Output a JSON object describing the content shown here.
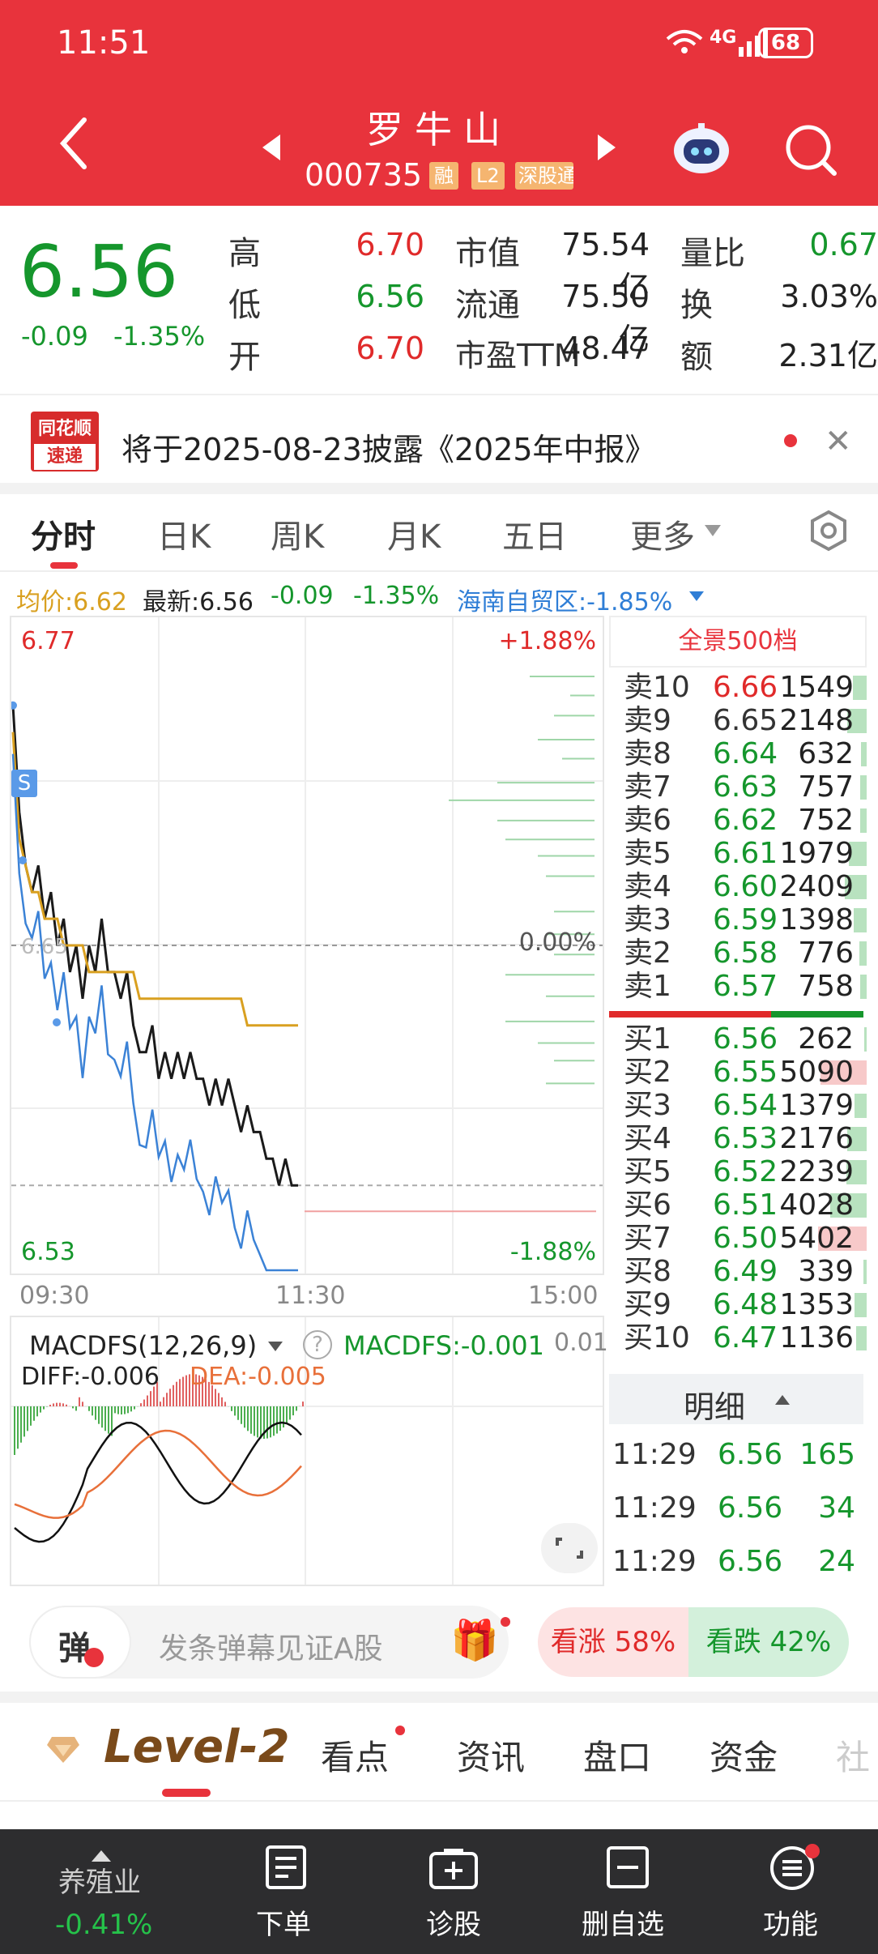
{
  "status": {
    "time": "11:51",
    "network": "4G",
    "battery": "68"
  },
  "header": {
    "name": "罗牛山",
    "code": "000735",
    "tags": [
      "融",
      "L2",
      "深股通"
    ]
  },
  "quote": {
    "price": "6.56",
    "change": "-0.09",
    "change_pct": "-1.35%",
    "stats": [
      {
        "label": "高",
        "value": "6.70"
      },
      {
        "label": "市值",
        "value": "75.54亿"
      },
      {
        "label": "量比",
        "value": "0.67"
      },
      {
        "label": "低",
        "value": "6.56"
      },
      {
        "label": "流通",
        "value": "75.50亿"
      },
      {
        "label": "换",
        "value": "3.03%"
      },
      {
        "label": "开",
        "value": "6.70"
      },
      {
        "label": "市盈TTM",
        "value": "48.47"
      },
      {
        "label": "额",
        "value": "2.31亿"
      }
    ]
  },
  "notice": {
    "badge_top": "同花顺",
    "badge_bottom": "速递",
    "text": "将于2025-08-23披露《2025年中报》"
  },
  "tabs": [
    "分时",
    "日K",
    "周K",
    "月K",
    "五日",
    "更多"
  ],
  "info_bar": {
    "avg": "均价:6.62",
    "latest": "最新:6.56",
    "chg": "-0.09",
    "pct": "-1.35%",
    "sector": "海南自贸区:-1.85%"
  },
  "chart_labels": {
    "top_price": "6.77",
    "bottom_price": "6.53",
    "top_pct": "+1.88%",
    "mid_pct": "0.00%",
    "bottom_pct": "-1.88%",
    "mid_price": "6.65",
    "t_start": "09:30",
    "t_mid": "11:30",
    "t_end": "15:00",
    "s_badge": "S"
  },
  "chart_data": {
    "type": "line",
    "ylim": [
      6.53,
      6.77
    ],
    "series": [
      {
        "name": "price",
        "values": [
          6.74,
          6.7,
          6.68,
          6.67,
          6.68,
          6.66,
          6.67,
          6.65,
          6.66,
          6.64,
          6.65,
          6.63,
          6.65,
          6.64,
          6.66,
          6.64,
          6.64,
          6.63,
          6.64,
          6.62,
          6.61,
          6.61,
          6.62,
          6.6,
          6.61,
          6.6,
          6.61,
          6.6,
          6.61,
          6.6,
          6.6,
          6.59,
          6.6,
          6.59,
          6.6,
          6.59,
          6.58,
          6.59,
          6.58,
          6.58,
          6.57,
          6.57,
          6.56,
          6.57,
          6.56,
          6.56
        ]
      },
      {
        "name": "均价",
        "values": [
          6.73,
          6.69,
          6.68,
          6.67,
          6.67,
          6.66,
          6.66,
          6.66,
          6.65,
          6.65,
          6.65,
          6.65,
          6.64,
          6.64,
          6.64,
          6.64,
          6.64,
          6.64,
          6.64,
          6.64,
          6.63,
          6.63,
          6.63,
          6.63,
          6.63,
          6.63,
          6.63,
          6.63,
          6.63,
          6.63,
          6.63,
          6.63,
          6.63,
          6.63,
          6.63,
          6.63,
          6.63,
          6.62,
          6.62,
          6.62,
          6.62,
          6.62,
          6.62,
          6.62,
          6.62,
          6.62
        ]
      }
    ]
  },
  "orderbook": {
    "title": "全景500档",
    "asks": [
      {
        "label": "卖10",
        "price": "6.66",
        "vol": "1549"
      },
      {
        "label": "卖9",
        "price": "6.65",
        "vol": "2148"
      },
      {
        "label": "卖8",
        "price": "6.64",
        "vol": "632"
      },
      {
        "label": "卖7",
        "price": "6.63",
        "vol": "757"
      },
      {
        "label": "卖6",
        "price": "6.62",
        "vol": "752"
      },
      {
        "label": "卖5",
        "price": "6.61",
        "vol": "1979"
      },
      {
        "label": "卖4",
        "price": "6.60",
        "vol": "2409"
      },
      {
        "label": "卖3",
        "price": "6.59",
        "vol": "1398"
      },
      {
        "label": "卖2",
        "price": "6.58",
        "vol": "776"
      },
      {
        "label": "卖1",
        "price": "6.57",
        "vol": "758"
      }
    ],
    "bids": [
      {
        "label": "买1",
        "price": "6.56",
        "vol": "262"
      },
      {
        "label": "买2",
        "price": "6.55",
        "vol": "5090"
      },
      {
        "label": "买3",
        "price": "6.54",
        "vol": "1379"
      },
      {
        "label": "买4",
        "price": "6.53",
        "vol": "2176"
      },
      {
        "label": "买5",
        "price": "6.52",
        "vol": "2239"
      },
      {
        "label": "买6",
        "price": "6.51",
        "vol": "4028"
      },
      {
        "label": "买7",
        "price": "6.50",
        "vol": "5402"
      },
      {
        "label": "买8",
        "price": "6.49",
        "vol": "339"
      },
      {
        "label": "买9",
        "price": "6.48",
        "vol": "1353"
      },
      {
        "label": "买10",
        "price": "6.47",
        "vol": "1136"
      }
    ],
    "detail_title": "明细",
    "trades": [
      {
        "time": "11:29",
        "price": "6.56",
        "vol": "165"
      },
      {
        "time": "11:29",
        "price": "6.56",
        "vol": "34"
      },
      {
        "time": "11:29",
        "price": "6.56",
        "vol": "24"
      }
    ]
  },
  "macd": {
    "name": "MACDFS(12,26,9)",
    "value": "MACDFS:-0.001",
    "diff": "DIFF:-0.006",
    "dea": "DEA:-0.005",
    "right_val": "0.01"
  },
  "danmu": {
    "char": "弹",
    "placeholder": "发条弹幕见证A股",
    "up": "看涨 58%",
    "down": "看跌 42%"
  },
  "bottom_tabs": [
    "Level-2",
    "看点",
    "资讯",
    "盘口",
    "资金",
    "社"
  ],
  "nav": {
    "sector_name": "养殖业",
    "sector_pct": "-0.41%",
    "items": [
      "下单",
      "诊股",
      "删自选",
      "功能"
    ]
  },
  "colors": {
    "header": "#e8333c",
    "up": "#e02a2a",
    "down": "#15962c",
    "avg_line": "#d9a020",
    "sector_line": "#3b82d6"
  }
}
